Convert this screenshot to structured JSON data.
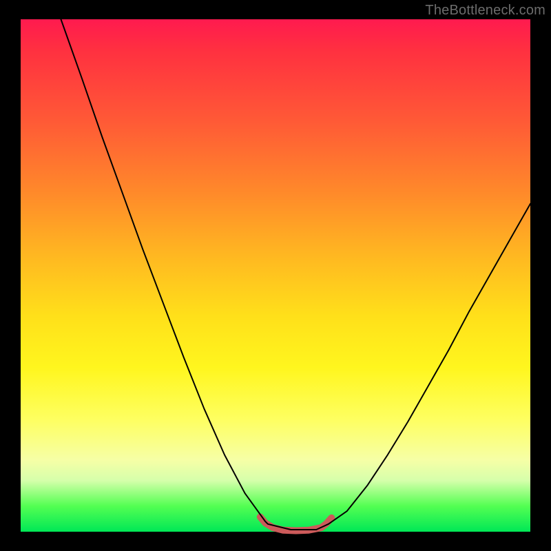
{
  "watermark": "TheBottleneck.com",
  "chart_data": {
    "type": "line",
    "title": "",
    "xlabel": "",
    "ylabel": "",
    "xlim": [
      0,
      1
    ],
    "ylim": [
      0,
      1
    ],
    "series": [
      {
        "name": "black-curve",
        "color": "#000000",
        "x": [
          0.079,
          0.12,
          0.16,
          0.2,
          0.24,
          0.28,
          0.32,
          0.36,
          0.4,
          0.44,
          0.48,
          0.485,
          0.53,
          0.58,
          0.604,
          0.64,
          0.68,
          0.72,
          0.76,
          0.8,
          0.84,
          0.88,
          0.92,
          0.96,
          1.0
        ],
        "y": [
          1.0,
          0.885,
          0.77,
          0.66,
          0.55,
          0.445,
          0.34,
          0.24,
          0.15,
          0.075,
          0.02,
          0.015,
          0.004,
          0.004,
          0.015,
          0.04,
          0.09,
          0.15,
          0.215,
          0.285,
          0.355,
          0.43,
          0.5,
          0.57,
          0.64
        ]
      },
      {
        "name": "valley-accent",
        "color": "#cc5a5a",
        "x": [
          0.47,
          0.48,
          0.495,
          0.515,
          0.54,
          0.565,
          0.59,
          0.6,
          0.61
        ],
        "y": [
          0.029,
          0.017,
          0.008,
          0.003,
          0.002,
          0.003,
          0.008,
          0.016,
          0.027
        ]
      }
    ],
    "suggested_render": {
      "black_curve_stroke_px": 2,
      "valley_accent_stroke_px": 10
    }
  }
}
